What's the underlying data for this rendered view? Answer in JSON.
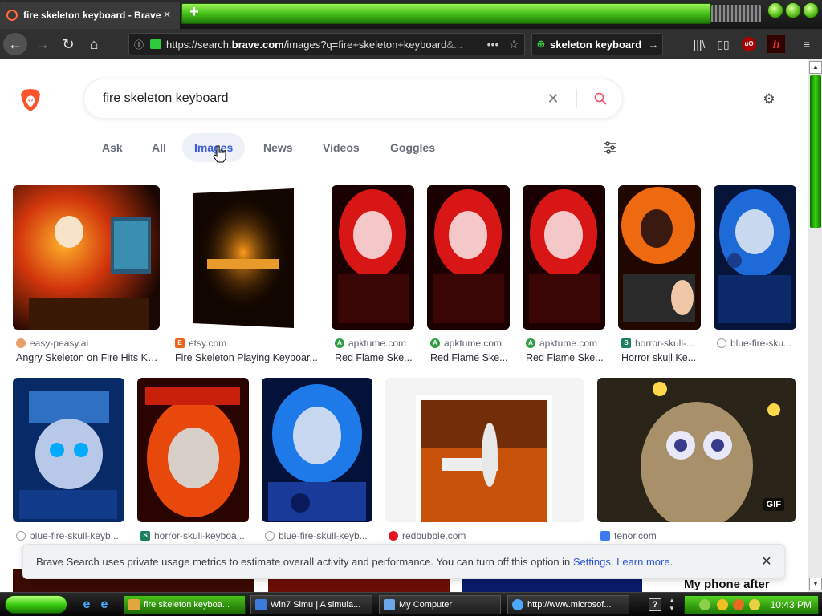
{
  "browser": {
    "tab_title": "fire skeleton keyboard - Brave Se...",
    "url_prefix": "https://search.",
    "url_domain": "brave.com",
    "url_path": "/images?q=fire+skeleton+keyboard",
    "url_tail": "&...",
    "search_text": "skeleton keyboard"
  },
  "search": {
    "query": "fire skeleton keyboard"
  },
  "tabs": [
    {
      "label": "Ask"
    },
    {
      "label": "All"
    },
    {
      "label": "Images"
    },
    {
      "label": "News"
    },
    {
      "label": "Videos"
    },
    {
      "label": "Goggles"
    }
  ],
  "results_row1": [
    {
      "source": "easy-peasy.ai",
      "caption": "Angry Skeleton on Fire Hits Ke...",
      "source_color": "#e8a06a"
    },
    {
      "source": "etsy.com",
      "caption": "Fire Skeleton Playing Keyboar...",
      "source_color": "#f1641e"
    },
    {
      "source": "apktume.com",
      "caption": "Red Flame Ske...",
      "source_color": "#2f9e44"
    },
    {
      "source": "apktume.com",
      "caption": "Red Flame Ske...",
      "source_color": "#2f9e44"
    },
    {
      "source": "apktume.com",
      "caption": "Red Flame Ske...",
      "source_color": "#2f9e44"
    },
    {
      "source": "horror-skull-...",
      "caption": "Horror skull Ke...",
      "source_color": "#1b7f5a"
    },
    {
      "source": "blue-fire-sku...",
      "caption": "",
      "source_color": "#9aa0a6"
    }
  ],
  "results_row2": [
    {
      "source": "blue-fire-skull-keyb...",
      "source_color": "#9aa0a6"
    },
    {
      "source": "horror-skull-keyboa...",
      "source_color": "#1b7f5a"
    },
    {
      "source": "blue-fire-skull-keyb...",
      "source_color": "#9aa0a6"
    },
    {
      "source": "redbubble.com",
      "source_color": "#e41321"
    },
    {
      "source": "tenor.com",
      "source_color": "#3b7cf6",
      "badge": "GIF"
    }
  ],
  "notice": {
    "message": "Brave Search uses private usage metrics to estimate overall activity and performance. You can turn off this option in ",
    "settings_link": "Settings",
    "separator": ". ",
    "learn_more": "Learn more",
    "end": "."
  },
  "bottom_peek": {
    "text": "My phone after"
  },
  "taskbar": {
    "items": [
      {
        "label": "fire skeleton keyboa..."
      },
      {
        "label": "Win7 Simu | A simula..."
      },
      {
        "label": "My Computer"
      },
      {
        "label": "http://www.microsof..."
      }
    ],
    "clock": "10:43 PM"
  },
  "colors": {
    "accent_blue": "#3b5bd9",
    "brave_orange": "#fb542b",
    "search_icon": "#e8506a",
    "theme_green": "#44c01a"
  }
}
